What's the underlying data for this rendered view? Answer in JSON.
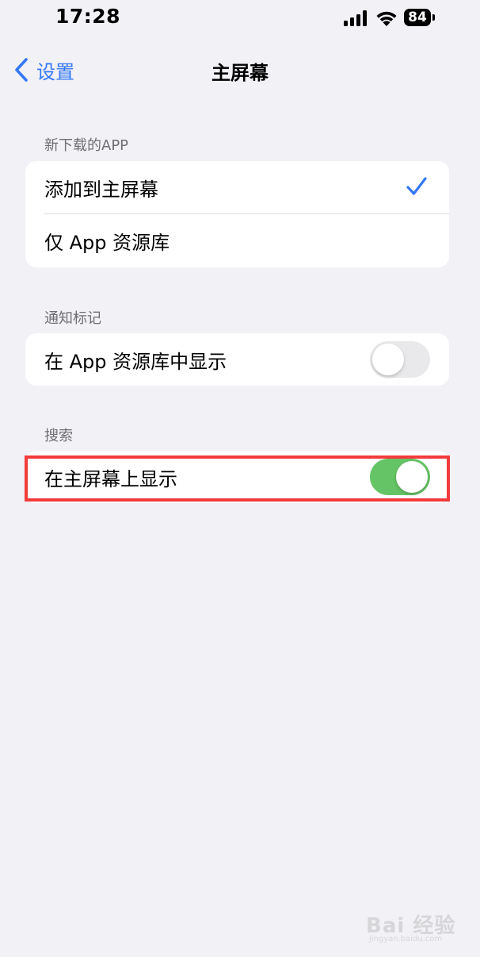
{
  "status_bar": {
    "time": "17:28",
    "battery": "84",
    "icons": [
      "cellular-signal-icon",
      "wifi-icon",
      "battery-icon"
    ]
  },
  "nav": {
    "back_label": "设置",
    "title": "主屏幕"
  },
  "sections": {
    "new_downloads": {
      "header": "新下载的APP",
      "options": [
        {
          "label": "添加到主屏幕",
          "selected": true
        },
        {
          "label": "仅 App 资源库",
          "selected": false
        }
      ]
    },
    "badges": {
      "header": "通知标记",
      "row_label": "在 App 资源库中显示",
      "toggle_on": false
    },
    "search": {
      "header": "搜索",
      "row_label": "在主屏幕上显示",
      "toggle_on": true
    }
  },
  "watermark": {
    "main": "Bai 经验",
    "sub": "jingyan.baidu.com"
  },
  "colors": {
    "background": "#f2f1f6",
    "accent": "#3478f6",
    "toggle_on": "#65c466",
    "toggle_off": "#e9e9eb",
    "highlight": "#f23b3b"
  }
}
